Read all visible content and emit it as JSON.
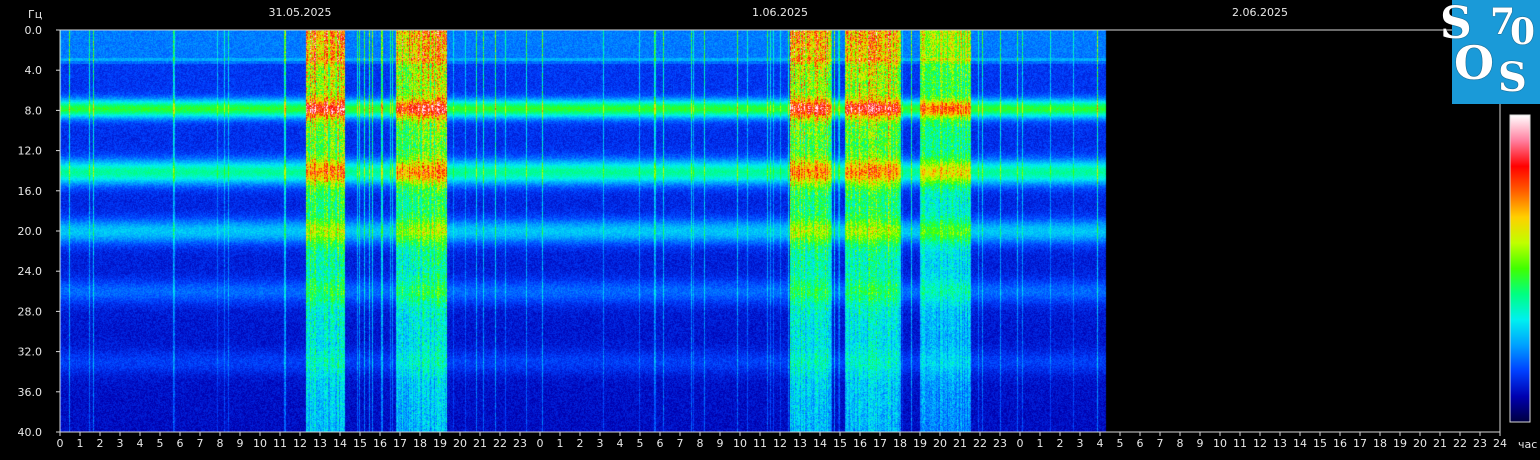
{
  "chart_data": {
    "type": "heatmap",
    "title": "",
    "ylabel": "Гц",
    "xlabel": "час",
    "ylim": [
      0,
      40
    ],
    "y_ticks": [
      "0.0",
      "4.0",
      "8.0",
      "12.0",
      "16.0",
      "20.0",
      "24.0",
      "28.0",
      "32.0",
      "36.0",
      "40.0"
    ],
    "dates": [
      "31.05.2025",
      "1.06.2025",
      "2.06.2025"
    ],
    "x_ticks": [
      "0",
      "1",
      "2",
      "3",
      "4",
      "5",
      "6",
      "7",
      "8",
      "9",
      "10",
      "11",
      "12",
      "13",
      "14",
      "15",
      "16",
      "17",
      "18",
      "19",
      "20",
      "21",
      "22",
      "23",
      "0",
      "1",
      "2",
      "3",
      "4",
      "5",
      "6",
      "7",
      "8",
      "9",
      "10",
      "11",
      "12",
      "13",
      "14",
      "15",
      "16",
      "17",
      "18",
      "19",
      "20",
      "21",
      "22",
      "23",
      "0",
      "1",
      "2",
      "3",
      "4",
      "5",
      "6",
      "7",
      "8",
      "9",
      "10",
      "11",
      "12",
      "13",
      "14",
      "15",
      "16",
      "17",
      "18",
      "19",
      "20",
      "21",
      "22",
      "23",
      "24"
    ],
    "x_range_hours": [
      0,
      72
    ],
    "data_end_hour": 52.3,
    "resonance_bands_hz": [
      7.8,
      14.1,
      20.0,
      26.0,
      33.0
    ],
    "bursts": [
      {
        "start_hour": 12.3,
        "end_hour": 14.2,
        "intensity": 1.0
      },
      {
        "start_hour": 16.8,
        "end_hour": 19.3,
        "intensity": 0.95
      },
      {
        "start_hour": 36.5,
        "end_hour": 38.5,
        "intensity": 1.0
      },
      {
        "start_hour": 39.2,
        "end_hour": 42.0,
        "intensity": 1.0
      },
      {
        "start_hour": 43.0,
        "end_hour": 45.5,
        "intensity": 0.7
      }
    ],
    "colorscale": [
      "#000040",
      "#0000b0",
      "#0040ff",
      "#00a0ff",
      "#00f0f0",
      "#00ff80",
      "#40ff00",
      "#c0ff00",
      "#ffd000",
      "#ff6000",
      "#ff0000",
      "#ff80a0",
      "#ffffff"
    ]
  },
  "logo": {
    "letters": [
      "S",
      "7",
      "0",
      "O",
      "S"
    ],
    "background": "#1a9ad8"
  }
}
